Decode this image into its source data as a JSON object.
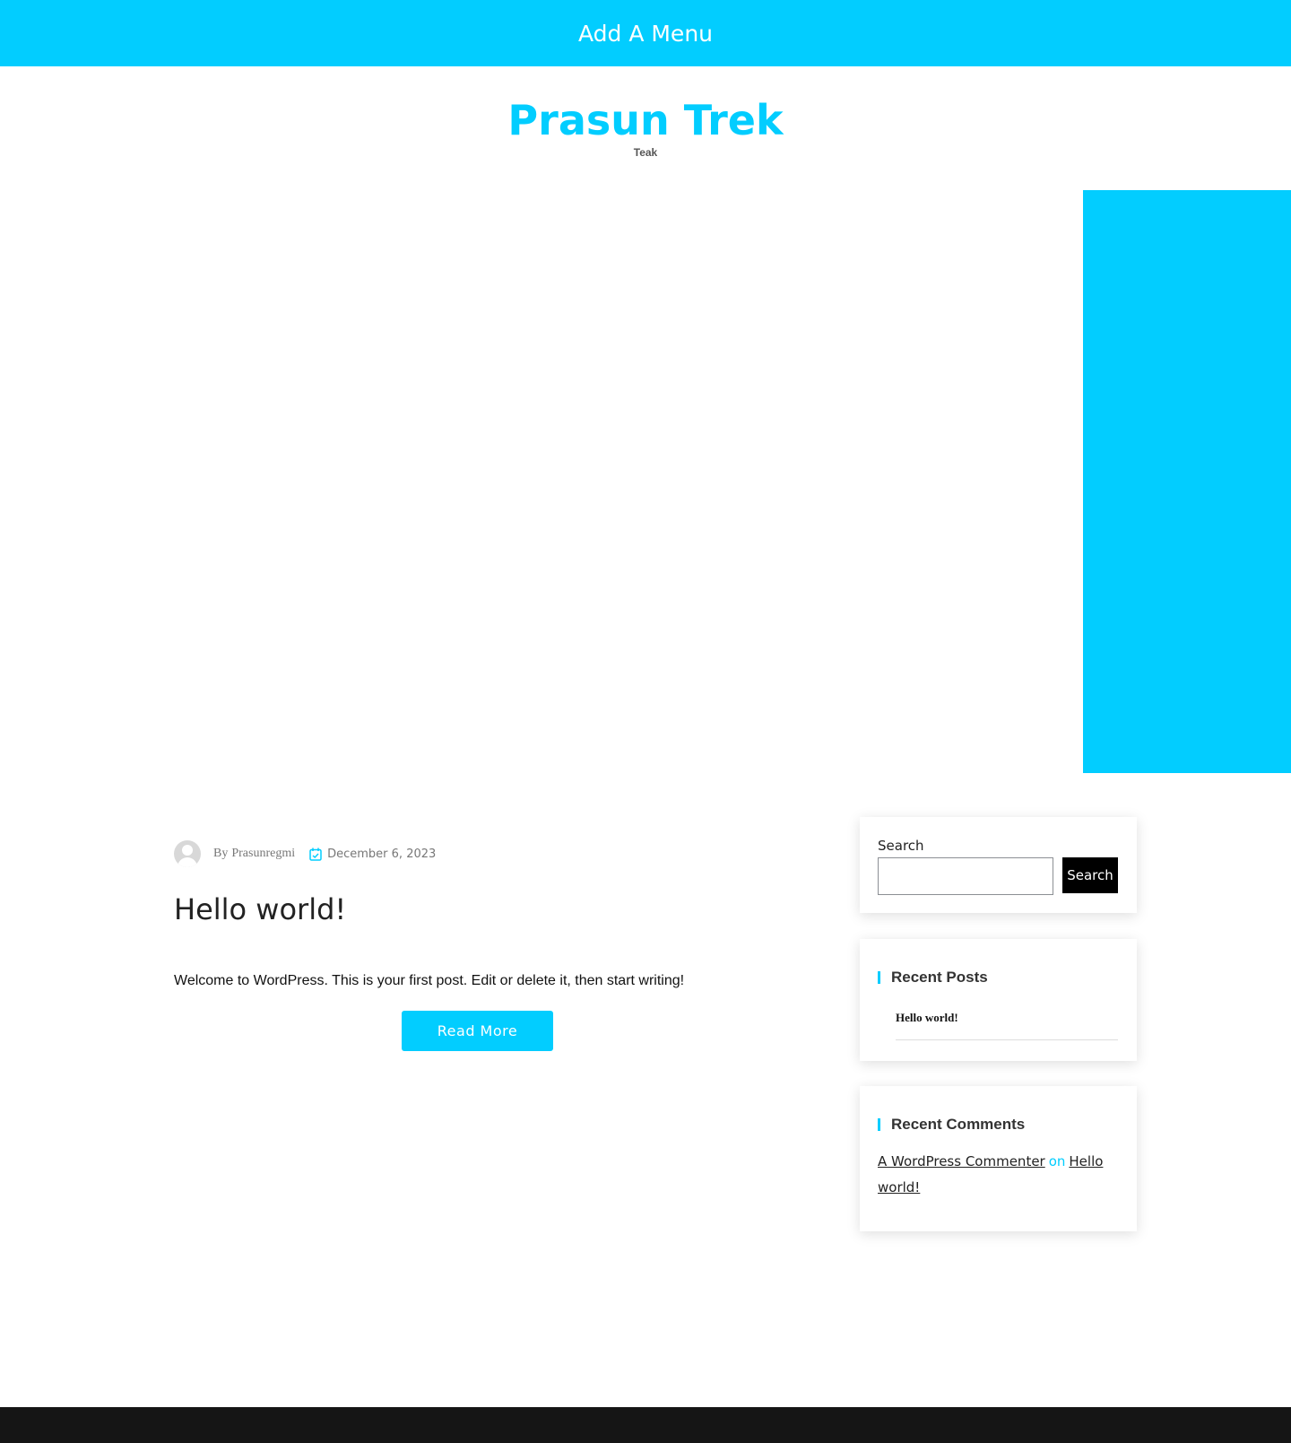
{
  "nav": {
    "menu_label": "Add A Menu"
  },
  "site": {
    "title": "Prasun Trek",
    "tagline": "Teak"
  },
  "colors": {
    "accent": "#02cdff",
    "footer": "#151515",
    "search_button": "#000000"
  },
  "post": {
    "by_label": "By",
    "author": "Prasunregmi",
    "date": "December 6, 2023",
    "title": "Hello world!",
    "excerpt": "Welcome to WordPress. This is your first post. Edit or delete it, then start writing!",
    "read_more_label": "Read More"
  },
  "sidebar": {
    "search": {
      "label": "Search",
      "input_value": "",
      "button_label": "Search"
    },
    "recent_posts": {
      "heading": "Recent Posts",
      "items": [
        "Hello world!"
      ]
    },
    "recent_comments": {
      "heading": "Recent Comments",
      "author": "A WordPress Commenter",
      "on_label": "on",
      "post": "Hello world!"
    }
  },
  "icons": {
    "avatar": "avatar-placeholder",
    "date": "calendar-check-icon"
  }
}
